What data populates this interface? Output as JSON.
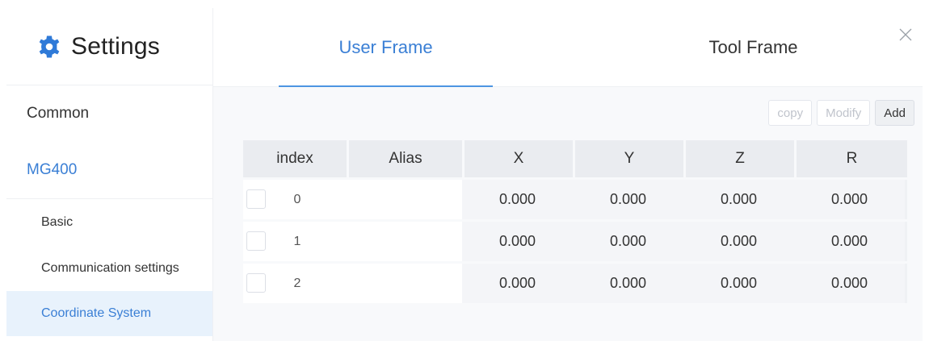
{
  "sidebar": {
    "title": "Settings",
    "common": "Common",
    "device": "MG400",
    "subitems": {
      "basic": "Basic",
      "communication": "Communication settings",
      "coordinate": "Coordinate System"
    }
  },
  "tabs": {
    "user_frame": "User Frame",
    "tool_frame": "Tool Frame"
  },
  "toolbar": {
    "copy": "copy",
    "modify": "Modify",
    "add": "Add"
  },
  "table": {
    "headers": [
      "index",
      "Alias",
      "X",
      "Y",
      "Z",
      "R"
    ],
    "rows": [
      {
        "index": "0",
        "alias": "",
        "x": "0.000",
        "y": "0.000",
        "z": "0.000",
        "r": "0.000"
      },
      {
        "index": "1",
        "alias": "",
        "x": "0.000",
        "y": "0.000",
        "z": "0.000",
        "r": "0.000"
      },
      {
        "index": "2",
        "alias": "",
        "x": "0.000",
        "y": "0.000",
        "z": "0.000",
        "r": "0.000"
      }
    ]
  },
  "colors": {
    "accent": "#3a7fd5",
    "active_bg": "#e8f2fc"
  },
  "icons": {
    "logo": "gear-icon",
    "close": "close-icon"
  }
}
